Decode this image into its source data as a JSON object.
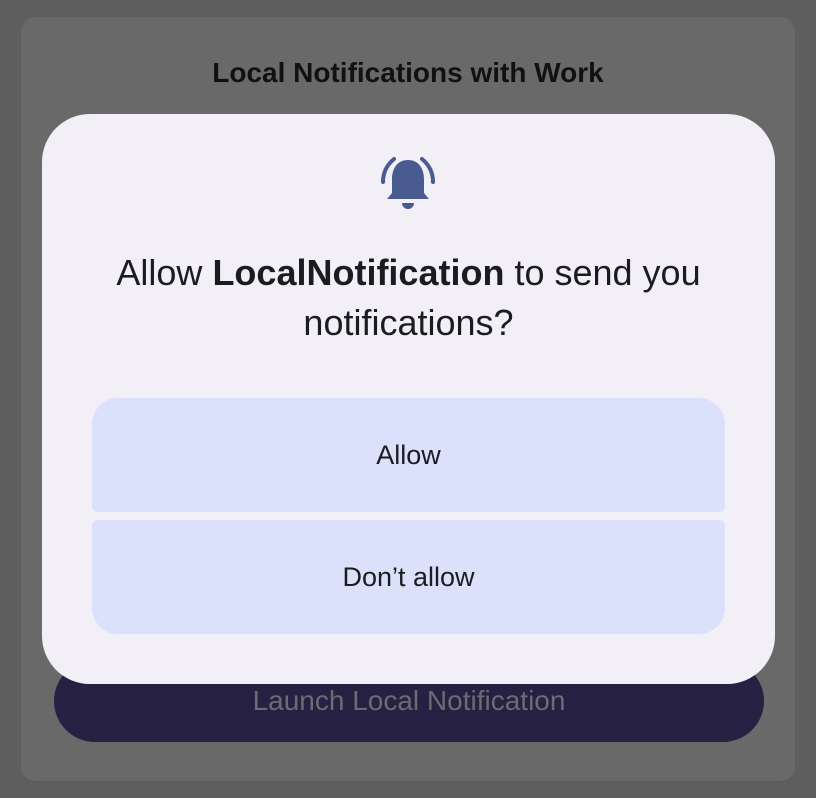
{
  "app": {
    "title": "Local Notifications with Work",
    "launch_button_label": "Launch Local Notification"
  },
  "dialog": {
    "icon": "bell-icon",
    "title_prefix": "Allow ",
    "app_name": "LocalNotification",
    "title_suffix": " to send you notifications?",
    "allow_label": "Allow",
    "deny_label": "Don’t allow"
  },
  "colors": {
    "scrim": "#5e5e5e",
    "dialog_background": "#f2eff6",
    "dialog_button": "#dbe0fb",
    "icon": "#4a5b92",
    "launch_button": "#262043"
  }
}
